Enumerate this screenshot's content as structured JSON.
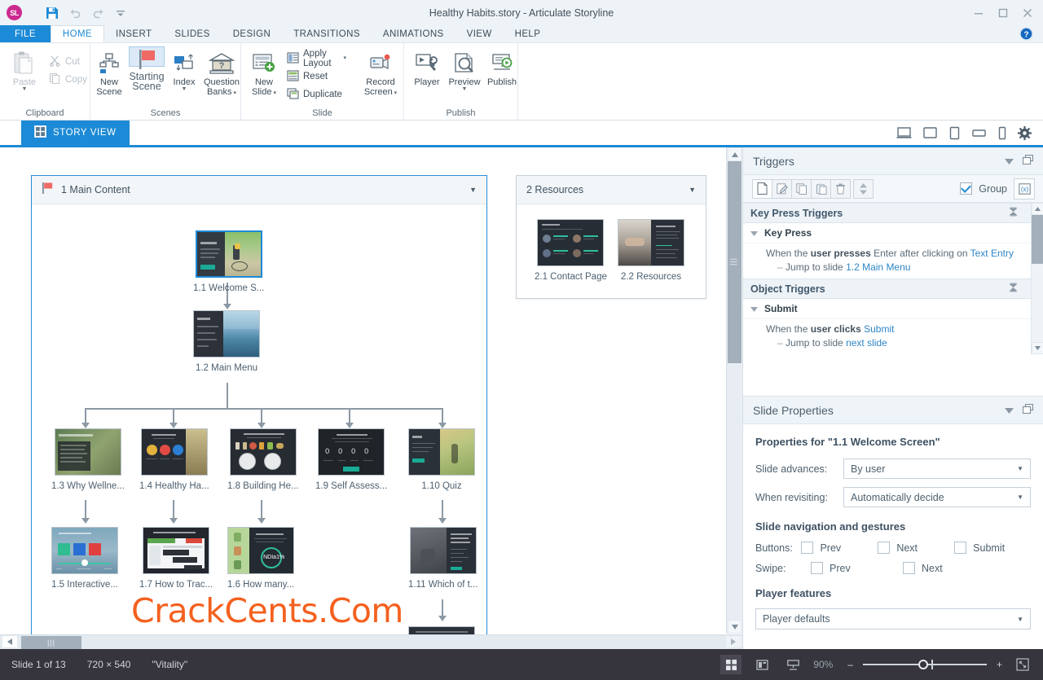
{
  "titlebar": {
    "logo_text": "SL",
    "title": "Healthy Habits.story -  Articulate Storyline",
    "quick_access": [
      {
        "name": "save-icon",
        "label": "Save"
      },
      {
        "name": "undo-icon",
        "label": "Undo"
      },
      {
        "name": "redo-icon",
        "label": "Redo"
      },
      {
        "name": "customize-qat-icon",
        "label": "Customize Quick Access Toolbar"
      }
    ],
    "window_controls": [
      {
        "name": "minimize-button",
        "glyph": "–"
      },
      {
        "name": "maximize-button",
        "glyph": "□"
      },
      {
        "name": "close-button",
        "glyph": "✕"
      }
    ],
    "help_icon": "help-icon"
  },
  "menu": {
    "tabs": [
      {
        "label": "FILE",
        "state": "file"
      },
      {
        "label": "HOME",
        "state": "active"
      },
      {
        "label": "INSERT",
        "state": "normal"
      },
      {
        "label": "SLIDES",
        "state": "normal"
      },
      {
        "label": "DESIGN",
        "state": "normal"
      },
      {
        "label": "TRANSITIONS",
        "state": "normal"
      },
      {
        "label": "ANIMATIONS",
        "state": "normal"
      },
      {
        "label": "VIEW",
        "state": "normal"
      },
      {
        "label": "HELP",
        "state": "normal"
      }
    ]
  },
  "ribbon": {
    "groups": [
      {
        "label": "Clipboard",
        "buttons": [
          {
            "name": "paste-button",
            "label": "Paste",
            "icon": "clipboard-icon",
            "disabled": true,
            "dropdown": true
          },
          {
            "name": "cut-button",
            "label": "Cut",
            "icon": "scissors-icon",
            "disabled": true
          },
          {
            "name": "copy-button",
            "label": "Copy",
            "icon": "copy-icon",
            "disabled": true
          }
        ]
      },
      {
        "label": "Scenes",
        "buttons": [
          {
            "name": "new-scene-button",
            "label": "New\nScene",
            "label1": "New",
            "label2": "Scene",
            "icon": "scene-tree-icon"
          },
          {
            "name": "starting-scene-button",
            "label1": "Starting",
            "label2": "Scene",
            "icon": "flag-icon",
            "selected": true
          },
          {
            "name": "index-button",
            "label1": "Index",
            "label2": "",
            "icon": "index-icon",
            "dropdown": true
          },
          {
            "name": "question-banks-button",
            "label1": "Question",
            "label2": "Banks",
            "icon": "bank-icon",
            "dropdown": true
          }
        ]
      },
      {
        "label": "Slide",
        "buttons": [
          {
            "name": "new-slide-button",
            "label1": "New",
            "label2": "Slide",
            "icon": "new-slide-icon",
            "dropdown": true
          },
          {
            "name": "apply-layout-button",
            "label": "Apply Layout",
            "icon": "layout-icon",
            "dropdown": true
          },
          {
            "name": "reset-button",
            "label": "Reset",
            "icon": "reset-icon"
          },
          {
            "name": "duplicate-button",
            "label": "Duplicate",
            "icon": "duplicate-icon"
          },
          {
            "name": "record-screen-button",
            "label1": "Record",
            "label2": "Screen",
            "icon": "camera-icon",
            "dropdown": true
          }
        ]
      },
      {
        "label": "Publish",
        "buttons": [
          {
            "name": "player-button",
            "label": "Player",
            "icon": "player-icon"
          },
          {
            "name": "preview-button",
            "label": "Preview",
            "icon": "magnifier-icon",
            "dropdown": true
          },
          {
            "name": "publish-button",
            "label": "Publish",
            "icon": "publish-icon"
          }
        ]
      }
    ]
  },
  "viewbar": {
    "story_view_label": "STORY VIEW",
    "story_view_icon": "grid-icon",
    "device_icons": [
      {
        "name": "desktop-preview-icon"
      },
      {
        "name": "tablet-landscape-preview-icon"
      },
      {
        "name": "tablet-portrait-preview-icon"
      },
      {
        "name": "phone-landscape-preview-icon"
      },
      {
        "name": "phone-portrait-preview-icon"
      },
      {
        "name": "settings-gear-icon"
      }
    ]
  },
  "canvas": {
    "watermark": "CrackCents.Com",
    "scenes": [
      {
        "name": "scene-main-content",
        "title": "1 Main Content",
        "has_flag": true,
        "selected": true,
        "slides": [
          {
            "id": "1.1",
            "label": "1.1 Welcome S...",
            "selected": true,
            "art": "bike"
          },
          {
            "id": "1.2",
            "label": "1.2 Main Menu",
            "selected": false,
            "art": "menu"
          },
          {
            "id": "1.3",
            "label": "1.3 Why Wellne...",
            "selected": false,
            "art": "wellness"
          },
          {
            "id": "1.4",
            "label": "1.4 Healthy Ha...",
            "selected": false,
            "art": "habits"
          },
          {
            "id": "1.8",
            "label": "1.8 Building He...",
            "selected": false,
            "art": "plates"
          },
          {
            "id": "1.9",
            "label": "1.9 Self Assess...",
            "selected": false,
            "art": "assess"
          },
          {
            "id": "1.10",
            "label": "1.10 Quiz",
            "selected": false,
            "art": "quiz"
          },
          {
            "id": "1.5",
            "label": "1.5 Interactive...",
            "selected": false,
            "art": "interactive"
          },
          {
            "id": "1.7",
            "label": "1.7 How to Trac...",
            "selected": false,
            "art": "track"
          },
          {
            "id": "1.6",
            "label": "1.6 How many...",
            "selected": false,
            "art": "calories"
          },
          {
            "id": "1.11",
            "label": "1.11 Which of t...",
            "selected": false,
            "art": "which"
          },
          {
            "id": "1.12",
            "label": "",
            "selected": false,
            "art": "last"
          }
        ]
      },
      {
        "name": "scene-resources",
        "title": "2 Resources",
        "has_flag": false,
        "selected": false,
        "slides": [
          {
            "id": "2.1",
            "label": "2.1 Contact Page",
            "selected": false,
            "art": "contact"
          },
          {
            "id": "2.2",
            "label": "2.2 Resources",
            "selected": false,
            "art": "resources"
          }
        ]
      }
    ]
  },
  "triggers_panel": {
    "title": "Triggers",
    "collapse_icon": "chevron-down-icon",
    "undock_icon": "undock-icon",
    "toolbar": [
      {
        "name": "new-trigger-button",
        "icon": "new-document-icon"
      },
      {
        "name": "edit-trigger-button",
        "icon": "edit-pencil-icon"
      },
      {
        "name": "copy-trigger-button",
        "icon": "copy-icon"
      },
      {
        "name": "paste-trigger-button",
        "icon": "paste-icon"
      },
      {
        "name": "delete-trigger-button",
        "icon": "trash-icon"
      },
      {
        "name": "reorder-trigger-spinner",
        "icon": "spinner-icon"
      }
    ],
    "group_label": "Group",
    "group_checked": true,
    "variables_icon": "variables-xy-icon",
    "sections": [
      {
        "name": "key-press-triggers-section",
        "header": "Key Press Triggers",
        "groups": [
          {
            "name": "Key Press",
            "triggers": [
              {
                "text_parts": [
                  {
                    "t": "When the ",
                    "style": "plain"
                  },
                  {
                    "t": "user presses",
                    "style": "bold"
                  },
                  {
                    "t": " Enter after clicking on ",
                    "style": "plain"
                  },
                  {
                    "t": "Text Entry",
                    "style": "link"
                  }
                ],
                "action": "Jump to slide ",
                "action_target": "1.2 Main Menu"
              }
            ]
          }
        ]
      },
      {
        "name": "object-triggers-section",
        "header": "Object Triggers",
        "groups": [
          {
            "name": "Submit",
            "triggers": [
              {
                "text_parts": [
                  {
                    "t": "When the ",
                    "style": "plain"
                  },
                  {
                    "t": "user clicks",
                    "style": "bold"
                  },
                  {
                    "t": " ",
                    "style": "plain"
                  },
                  {
                    "t": "Submit",
                    "style": "link"
                  }
                ],
                "action": "Jump to slide ",
                "action_target": "next slide"
              }
            ]
          }
        ]
      }
    ]
  },
  "slide_properties": {
    "title": "Slide Properties",
    "collapse_icon": "chevron-down-icon",
    "undock_icon": "undock-icon",
    "heading": "Properties for \"1.1 Welcome Screen\"",
    "slide_advances_label": "Slide advances:",
    "slide_advances_value": "By user",
    "when_revisiting_label": "When revisiting:",
    "when_revisiting_value": "Automatically decide",
    "navigation_heading": "Slide navigation and gestures",
    "buttons_label": "Buttons:",
    "buttons": [
      {
        "label": "Prev",
        "checked": false
      },
      {
        "label": "Next",
        "checked": false
      },
      {
        "label": "Submit",
        "checked": false
      }
    ],
    "swipe_label": "Swipe:",
    "swipe": [
      {
        "label": "Prev",
        "checked": false
      },
      {
        "label": "Next",
        "checked": false
      }
    ],
    "player_features_heading": "Player features",
    "player_features_value": "Player defaults"
  },
  "statusbar": {
    "slide_counter": "Slide 1 of 13",
    "dimensions": "720 × 540",
    "theme": "\"Vitality\"",
    "zoom_value": "90%",
    "zoom_minus": "–",
    "zoom_plus": "+",
    "view_buttons": [
      {
        "name": "story-view-button",
        "icon": "grid-view-icon",
        "active": true
      },
      {
        "name": "slide-view-button",
        "icon": "slide-view-icon",
        "active": false
      },
      {
        "name": "form-view-button",
        "icon": "form-view-icon",
        "active": false
      }
    ],
    "fit_button": {
      "name": "fit-to-window-button",
      "icon": "fit-window-icon"
    }
  }
}
